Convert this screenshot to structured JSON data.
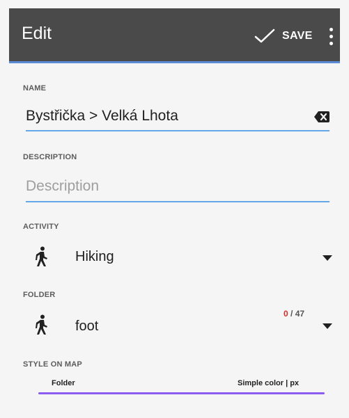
{
  "appbar": {
    "title": "Edit",
    "save_label": "SAVE"
  },
  "name": {
    "label": "NAME",
    "value": "Bystřička > Velká Lhota"
  },
  "description": {
    "label": "DESCRIPTION",
    "placeholder": "Description"
  },
  "activity": {
    "label": "ACTIVITY",
    "value": "Hiking"
  },
  "folder": {
    "label": "FOLDER",
    "value": "foot",
    "count_current": "0",
    "count_total": "/ 47"
  },
  "style_on_map": {
    "label": "STYLE ON MAP",
    "source": "Folder",
    "style": "Simple color | px",
    "line_color": "#8a5cf0"
  },
  "colors": {
    "appbar": "#4a4a4a",
    "accent": "#5b8bd6",
    "underline": "#64a7e8"
  }
}
